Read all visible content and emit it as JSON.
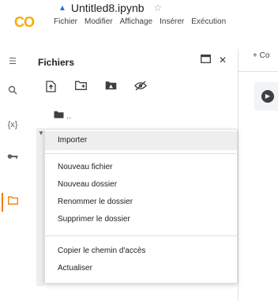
{
  "header": {
    "logo_text": "CO",
    "notebook_title": "Untitled8.ipynb",
    "menu": [
      "Fichier",
      "Modifier",
      "Affichage",
      "Insérer",
      "Exécution"
    ]
  },
  "rail": {
    "icons": [
      "menu-icon",
      "search-icon",
      "variables-icon",
      "key-icon",
      "folder-icon"
    ],
    "variables_label": "{x}"
  },
  "panel": {
    "title": "Fichiers",
    "folder_label": ".."
  },
  "context_menu": {
    "items": [
      "Importer",
      "Nouveau fichier",
      "Nouveau dossier",
      "Renommer le dossier",
      "Supprimer le dossier",
      "Copier le chemin d'accès",
      "Actualiser"
    ]
  },
  "right_pane": {
    "add_code_label": "+ Co"
  },
  "colors": {
    "accent_orange": "#f57c00",
    "logo_yellow": "#F9AB00",
    "menu_hover": "#eeeeee"
  }
}
